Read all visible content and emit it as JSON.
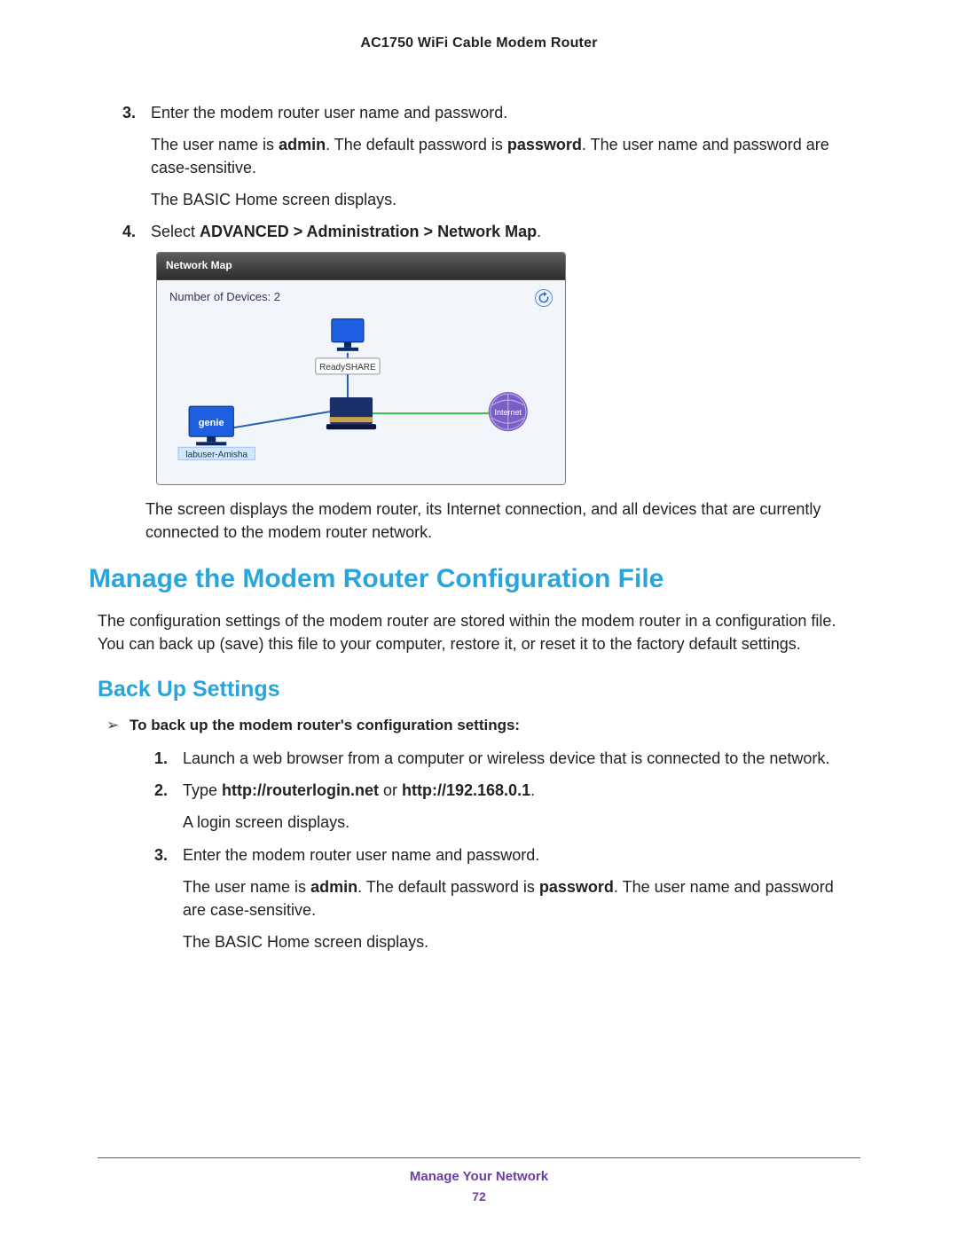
{
  "header": {
    "doc_title": "AC1750 WiFi Cable Modem Router"
  },
  "steps_top": {
    "s3": {
      "num": "3.",
      "text": "Enter the modem router user name and password.",
      "cred_pre": "The user name is ",
      "cred_admin": "admin",
      "cred_mid": ". The default password is ",
      "cred_pw": "password",
      "cred_post": ". The user name and password are case-sensitive.",
      "basic": "The BASIC Home screen displays."
    },
    "s4": {
      "num": "4.",
      "pre": "Select ",
      "path": "ADVANCED > Administration > Network Map",
      "post": "."
    },
    "after_nm": "The screen displays the modem router, its Internet connection, and all devices that are currently connected to the modem router network."
  },
  "network_map": {
    "title": "Network Map",
    "devices_label": "Number of Devices: 2",
    "ready": "ReadySHARE",
    "client_badge": "genie",
    "client_name": "labuser-Amisha",
    "internet": "Internet"
  },
  "h1_text": "Manage the Modem Router Configuration File",
  "intro_text": "The configuration settings of the modem router are stored within the modem router in a configuration file. You can back up (save) this file to your computer, restore it, or reset it to the factory default settings.",
  "h2_text": "Back Up Settings",
  "arrow_text": "To back up the modem router's configuration settings:",
  "steps_bottom": {
    "s1": {
      "num": "1.",
      "text": "Launch a web browser from a computer or wireless device that is connected to the network."
    },
    "s2": {
      "num": "2.",
      "pre": "Type ",
      "url1": "http://routerlogin.net",
      "or": " or ",
      "url2": "http://192.168.0.1",
      "post": ".",
      "after": "A login screen displays."
    },
    "s3": {
      "num": "3.",
      "text": "Enter the modem router user name and password.",
      "cred_pre": "The user name is ",
      "cred_admin": "admin",
      "cred_mid": ". The default password is ",
      "cred_pw": "password",
      "cred_post": ". The user name and password are case-sensitive.",
      "basic": "The BASIC Home screen displays."
    }
  },
  "footer": {
    "section": "Manage Your Network",
    "page": "72"
  }
}
